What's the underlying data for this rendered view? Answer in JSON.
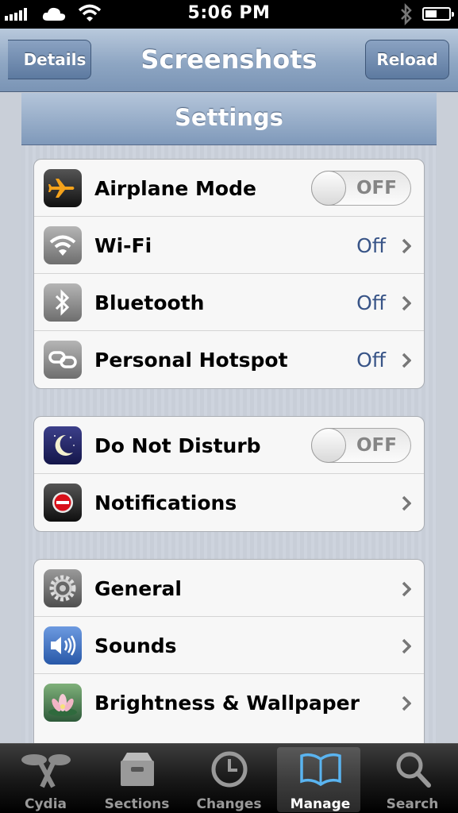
{
  "status_bar": {
    "time": "5:06 PM"
  },
  "nav": {
    "back_label": "Details",
    "title": "Screenshots",
    "reload_label": "Reload"
  },
  "screenshot": {
    "title": "Settings",
    "groups": [
      [
        {
          "label": "Airplane Mode",
          "toggle": "OFF",
          "icon": "airplane-icon"
        },
        {
          "label": "Wi-Fi",
          "value": "Off",
          "icon": "wifi-icon"
        },
        {
          "label": "Bluetooth",
          "value": "Off",
          "icon": "bluetooth-icon"
        },
        {
          "label": "Personal Hotspot",
          "value": "Off",
          "icon": "hotspot-icon"
        }
      ],
      [
        {
          "label": "Do Not Disturb",
          "toggle": "OFF",
          "icon": "moon-icon"
        },
        {
          "label": "Notifications",
          "icon": "notifications-icon"
        }
      ],
      [
        {
          "label": "General",
          "icon": "gear-icon"
        },
        {
          "label": "Sounds",
          "icon": "speaker-icon"
        },
        {
          "label": "Brightness & Wallpaper",
          "icon": "flower-icon"
        }
      ]
    ]
  },
  "tabs": [
    {
      "label": "Cydia",
      "icon": "cydia-icon"
    },
    {
      "label": "Sections",
      "icon": "sections-icon"
    },
    {
      "label": "Changes",
      "icon": "clock-icon"
    },
    {
      "label": "Manage",
      "icon": "book-icon",
      "active": true
    },
    {
      "label": "Search",
      "icon": "search-icon"
    }
  ]
}
